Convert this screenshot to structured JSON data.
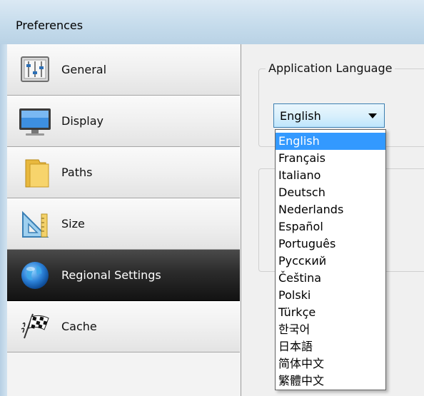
{
  "window": {
    "title": "Preferences"
  },
  "sidebar": {
    "items": [
      {
        "label": "General",
        "icon": "equalizer-icon",
        "selected": false
      },
      {
        "label": "Display",
        "icon": "monitor-icon",
        "selected": false
      },
      {
        "label": "Paths",
        "icon": "folder-icon",
        "selected": false
      },
      {
        "label": "Size",
        "icon": "ruler-icon",
        "selected": false
      },
      {
        "label": "Regional Settings",
        "icon": "globe-icon",
        "selected": true
      },
      {
        "label": "Cache",
        "icon": "checkered-flag-icon",
        "selected": false
      }
    ]
  },
  "main": {
    "language_group_title": "Application Language",
    "language_select": {
      "value": "English",
      "options": [
        "English",
        "Français",
        "Italiano",
        "Deutsch",
        "Nederlands",
        "Español",
        "Português",
        "Русский",
        "Čeština",
        "Polski",
        "Türkçe",
        "한국어",
        "日本語",
        "简体中文",
        "繁體中文"
      ],
      "highlighted_index": 0
    }
  },
  "colors": {
    "selection_highlight": "#3399ff",
    "selected_nav_bg": "#1e1e1e",
    "titlebar": "#c6dcec"
  }
}
